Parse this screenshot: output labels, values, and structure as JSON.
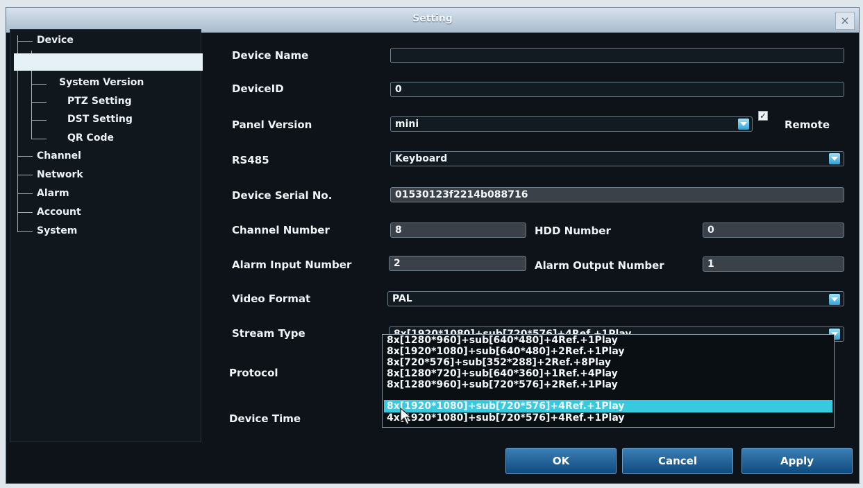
{
  "window": {
    "title": "Setting",
    "close_glyph": "×"
  },
  "tree": {
    "device": "Device",
    "device_children": [
      "System Version",
      "PTZ Setting",
      "DST Setting",
      "QR Code"
    ],
    "others": [
      "Channel",
      "Network",
      "Alarm",
      "Account",
      "System"
    ]
  },
  "form": {
    "device_name": {
      "label": "Device Name",
      "value": ""
    },
    "device_id": {
      "label": "DeviceID",
      "value": "0"
    },
    "panel_version": {
      "label": "Panel Version",
      "value": "mini"
    },
    "remote": {
      "label": "Remote",
      "checked": true,
      "check_glyph": "✓"
    },
    "rs485": {
      "label": "RS485",
      "value": "Keyboard"
    },
    "serial": {
      "label": "Device Serial No.",
      "value": "01530123f2214b088716"
    },
    "channel_number": {
      "label": "Channel Number",
      "value": "8"
    },
    "hdd_number": {
      "label": "HDD Number",
      "value": "0"
    },
    "alarm_input": {
      "label": "Alarm Input Number",
      "value": "2"
    },
    "alarm_output": {
      "label": "Alarm Output Number",
      "value": "1"
    },
    "video_format": {
      "label": "Video Format",
      "value": "PAL"
    },
    "stream_type": {
      "label": "Stream Type",
      "value": "8x[1920*1080]+sub[720*576]+4Ref.+1Play",
      "options": [
        "8x[1280*960]+sub[640*480]+4Ref.+1Play",
        "8x[1920*1080]+sub[640*480]+2Ref.+1Play",
        "8x[720*576]+sub[352*288]+2Ref.+8Play",
        "8x[1280*720]+sub[640*360]+1Ref.+4Play",
        "8x[1280*960]+sub[720*576]+2Ref.+1Play",
        "8x[1920*1080]+sub[720*576]+4Ref.+1Play",
        "4x[1920*1080]+sub[720*576]+4Ref.+1Play"
      ],
      "highlighted_option": "8x[1920*1080]+sub[720*576]+4Ref.+1Play"
    },
    "protocol": {
      "label": "Protocol"
    },
    "device_time": {
      "label": "Device Time"
    }
  },
  "buttons": {
    "ok": "OK",
    "cancel": "Cancel",
    "apply": "Apply"
  },
  "colors": {
    "accent": "#36c9e0",
    "button": "#1f5f96",
    "background": "#0d1319"
  }
}
